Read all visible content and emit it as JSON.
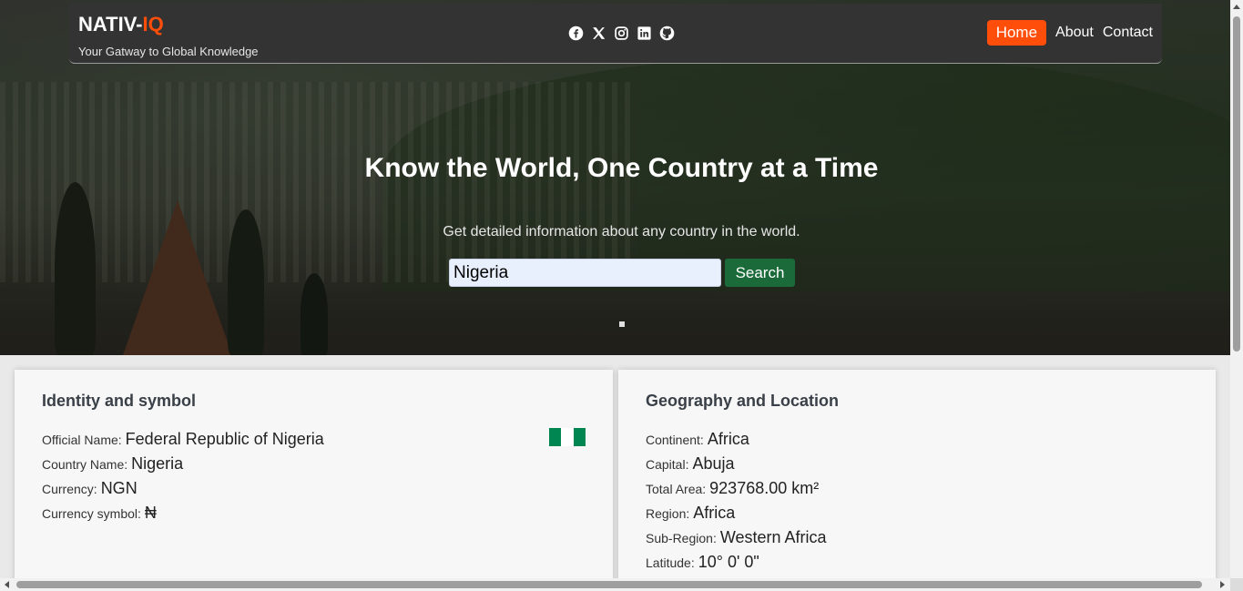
{
  "brand": {
    "name_main": "NATIV-",
    "name_accent": "IQ",
    "tagline": "Your Gatway to Global Knowledge"
  },
  "socials": [
    {
      "icon": "facebook-icon"
    },
    {
      "icon": "x-icon"
    },
    {
      "icon": "instagram-icon"
    },
    {
      "icon": "linkedin-icon"
    },
    {
      "icon": "github-icon"
    }
  ],
  "nav": {
    "home": "Home",
    "about": "About",
    "contact": "Contact"
  },
  "hero": {
    "title": "Know the World, One Country at a Time",
    "subtitle": "Get detailed information about any country in the world.",
    "search_value": "Nigeria",
    "search_button": "Search"
  },
  "identity": {
    "heading": "Identity and symbol",
    "official_name_label": "Official Name:",
    "official_name": "Federal Republic of Nigeria",
    "country_name_label": "Country Name:",
    "country_name": "Nigeria",
    "currency_label": "Currency:",
    "currency": "NGN",
    "currency_symbol_label": "Currency symbol:",
    "currency_symbol": "₦",
    "flag_colors": [
      "#008751",
      "#ffffff",
      "#008751"
    ]
  },
  "geography": {
    "heading": "Geography and Location",
    "continent_label": "Continent:",
    "continent": "Africa",
    "capital_label": "Capital:",
    "capital": "Abuja",
    "area_label": "Total Area:",
    "area": "923768.00 km²",
    "region_label": "Region:",
    "region": "Africa",
    "subregion_label": "Sub-Region:",
    "subregion": "Western Africa",
    "latitude_label": "Latitude:",
    "latitude": "10° 0' 0\""
  },
  "colors": {
    "accent": "#ff4d0a",
    "search_button": "#1b6b3a",
    "navbar": "#333333"
  }
}
